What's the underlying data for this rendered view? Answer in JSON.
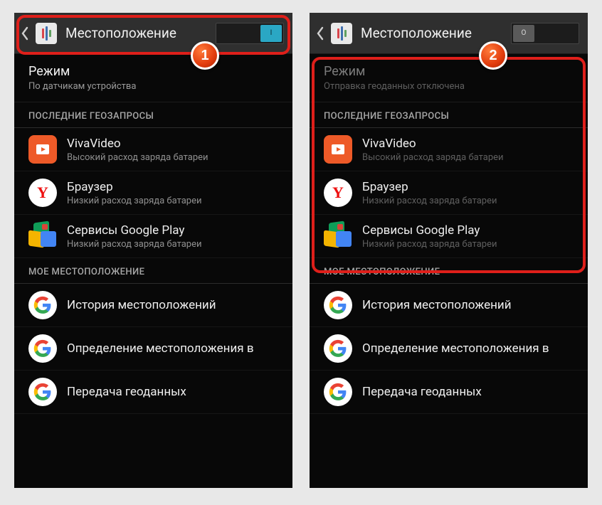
{
  "left": {
    "title": "Местоположение",
    "toggle": {
      "state": "on",
      "label": "I"
    },
    "mode": {
      "title": "Режим",
      "subtitle": "По датчикам устройства"
    },
    "sections": {
      "recent": "ПОСЛЕДНИЕ ГЕОЗАПРОСЫ",
      "my": "МОЕ МЕСТОПОЛОЖЕНИЕ"
    },
    "recent_apps": [
      {
        "name": "VivaVideo",
        "sub": "Высокий расход заряда батареи",
        "icon": "viva"
      },
      {
        "name": "Браузер",
        "sub": "Низкий расход заряда батареи",
        "icon": "yandex"
      },
      {
        "name": "Сервисы Google Play",
        "sub": "Низкий расход заряда батареи",
        "icon": "play"
      }
    ],
    "my_items": [
      {
        "name": "История местоположений"
      },
      {
        "name": "Определение местоположения в"
      },
      {
        "name": "Передача геоданных"
      }
    ],
    "badge": "1"
  },
  "right": {
    "title": "Местоположение",
    "toggle": {
      "state": "off",
      "label": "O"
    },
    "mode": {
      "title": "Режим",
      "subtitle": "Отправка геоданных отключена"
    },
    "sections": {
      "recent": "ПОСЛЕДНИЕ ГЕОЗАПРОСЫ",
      "my": "МОЕ МЕСТОПОЛОЖЕНИЕ"
    },
    "recent_apps": [
      {
        "name": "VivaVideo",
        "sub": "Высокий расход заряда батареи",
        "icon": "viva"
      },
      {
        "name": "Браузер",
        "sub": "Низкий расход заряда батареи",
        "icon": "yandex"
      },
      {
        "name": "Сервисы Google Play",
        "sub": "Низкий расход заряда батареи",
        "icon": "play"
      }
    ],
    "my_items": [
      {
        "name": "История местоположений"
      },
      {
        "name": "Определение местоположения в"
      },
      {
        "name": "Передача геоданных"
      }
    ],
    "badge": "2"
  }
}
